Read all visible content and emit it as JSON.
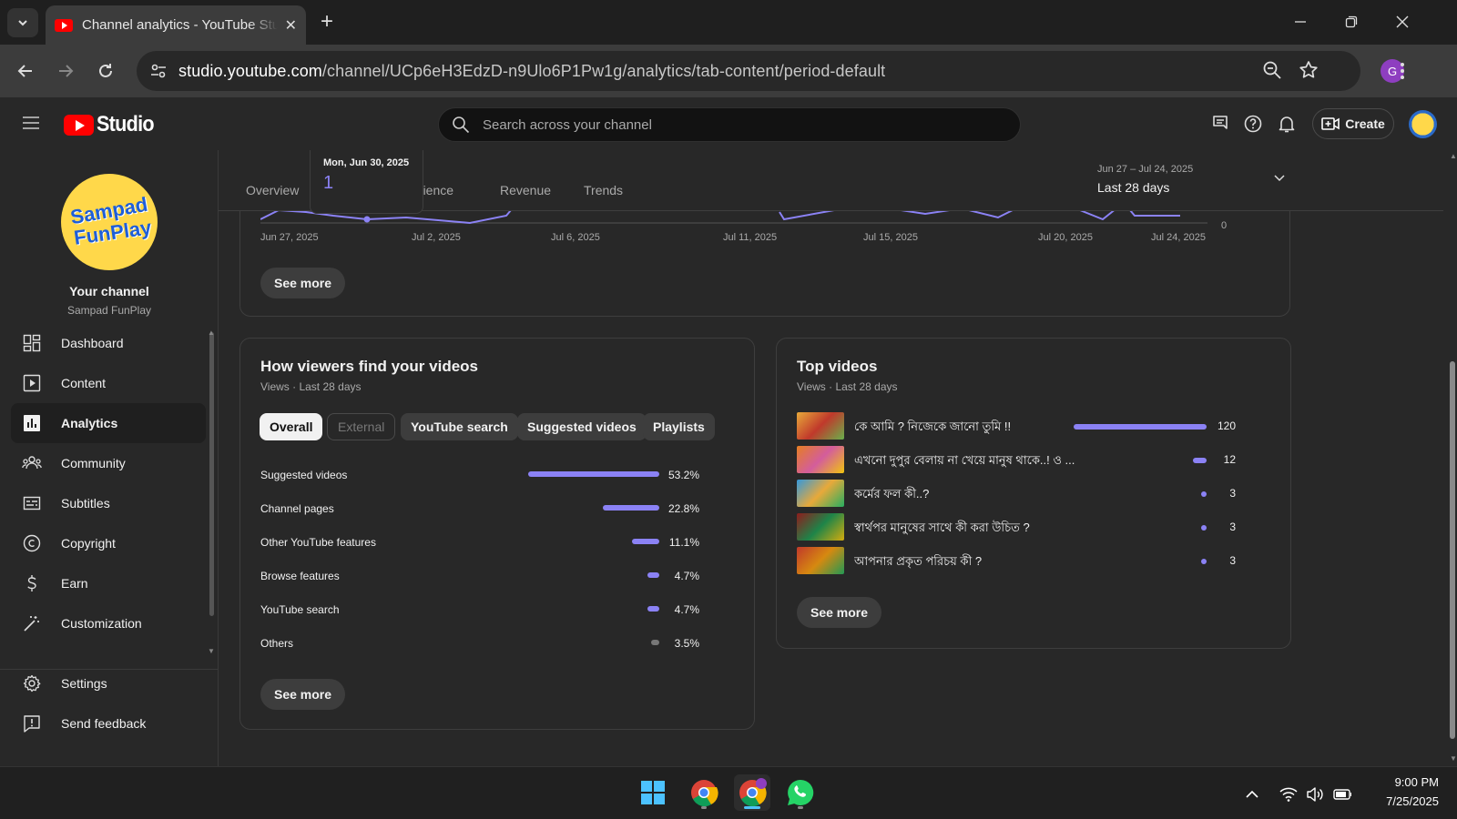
{
  "browser": {
    "tab_title": "Channel analytics - YouTube Studio",
    "url_host": "studio.youtube.com",
    "url_path": "/channel/UCp6eH3EdzD-n9Ulo6P1Pw1g/analytics/tab-content/period-default",
    "profile_letter": "G"
  },
  "header": {
    "logo_text": "Studio",
    "search_placeholder": "Search across your channel",
    "create_label": "Create"
  },
  "sidebar": {
    "avatar_line1": "Sampad",
    "avatar_line2": "FunPlay",
    "your_channel": "Your channel",
    "channel_name": "Sampad FunPlay",
    "items": [
      {
        "label": "Dashboard",
        "icon": "dashboard-icon"
      },
      {
        "label": "Content",
        "icon": "content-icon"
      },
      {
        "label": "Analytics",
        "icon": "analytics-icon",
        "active": true
      },
      {
        "label": "Community",
        "icon": "community-icon"
      },
      {
        "label": "Subtitles",
        "icon": "subtitles-icon"
      },
      {
        "label": "Copyright",
        "icon": "copyright-icon"
      },
      {
        "label": "Earn",
        "icon": "dollar-icon"
      },
      {
        "label": "Customization",
        "icon": "magic-wand-icon"
      }
    ],
    "bottom_items": [
      {
        "label": "Settings",
        "icon": "gear-icon"
      },
      {
        "label": "Send feedback",
        "icon": "feedback-icon"
      }
    ]
  },
  "analytics": {
    "tabs": [
      "Overview",
      "Audience",
      "Revenue",
      "Trends"
    ],
    "tab_audience_visible": "udience",
    "date_range_sub": "Jun 27 – Jul 24, 2025",
    "date_range": "Last 28 days",
    "tooltip": {
      "date": "Mon, Jun 30, 2025",
      "value": "1"
    },
    "chart_x_ticks": [
      "Jun 27, 2025",
      "Jul 2, 2025",
      "Jul 6, 2025",
      "Jul 11, 2025",
      "Jul 15, 2025",
      "Jul 20, 2025",
      "Jul 24, 2025"
    ],
    "chart_y_zero": "0",
    "see_more": "See more"
  },
  "traffic": {
    "title": "How viewers find your videos",
    "subtitle": "Views · Last 28 days",
    "chips": [
      {
        "label": "Overall",
        "state": "selected"
      },
      {
        "label": "External",
        "state": "disabled"
      },
      {
        "label": "YouTube search",
        "state": "normal"
      },
      {
        "label": "Suggested videos",
        "state": "normal"
      },
      {
        "label": "Playlists",
        "state": "normal"
      }
    ],
    "rows": [
      {
        "label": "Suggested videos",
        "pct": "53.2%",
        "value": 53.2
      },
      {
        "label": "Channel pages",
        "pct": "22.8%",
        "value": 22.8
      },
      {
        "label": "Other YouTube features",
        "pct": "11.1%",
        "value": 11.1
      },
      {
        "label": "Browse features",
        "pct": "4.7%",
        "value": 4.7
      },
      {
        "label": "YouTube search",
        "pct": "4.7%",
        "value": 4.7
      },
      {
        "label": "Others",
        "pct": "3.5%",
        "value": 3.5
      }
    ],
    "bar_color": "#8b82f5",
    "others_color": "#777777",
    "see_more": "See more"
  },
  "top_videos": {
    "title": "Top videos",
    "subtitle": "Views · Last 28 days",
    "rows": [
      {
        "title": "কে আমি ? নিজেকে জানো তুমি !!",
        "views": "120",
        "value": 120
      },
      {
        "title": "এখনো দুপুর বেলায় না খেয়ে মানুষ থাকে..! ও ...",
        "views": "12",
        "value": 12
      },
      {
        "title": "কর্মের ফল কী..?",
        "views": "3",
        "value": 3
      },
      {
        "title": "স্বার্থপর মানুষের সাথে কী করা উচিত ?",
        "views": "3",
        "value": 3
      },
      {
        "title": "আপনার প্রকৃত পরিচয় কী ?",
        "views": "3",
        "value": 3
      }
    ],
    "see_more": "See more"
  },
  "taskbar": {
    "time": "9:00 PM",
    "date": "7/25/2025"
  }
}
